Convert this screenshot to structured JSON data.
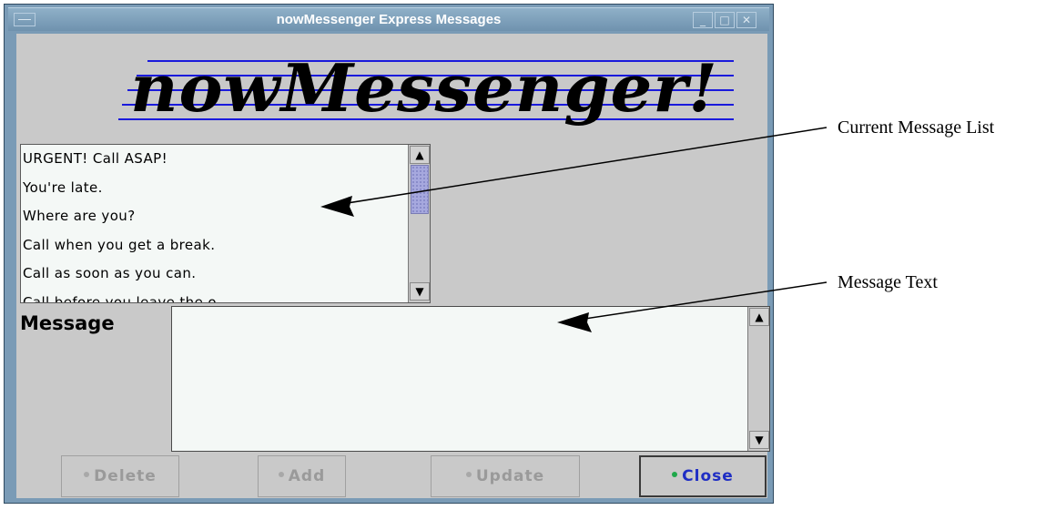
{
  "window": {
    "title": "nowMessenger Express Messages",
    "logo_text": "nowMessenger!"
  },
  "message_list": {
    "items": [
      "URGENT! Call ASAP!",
      "You're late.",
      "Where are you?",
      "Call when you get a break.",
      "Call as soon as you can.",
      "Call before you leave the o"
    ]
  },
  "message": {
    "label": "Message",
    "text": ""
  },
  "buttons": {
    "delete": "Delete",
    "add": "Add",
    "update": "Update",
    "close": "Close"
  },
  "annotations": {
    "message_list": "Current Message List",
    "message_text": "Message Text"
  },
  "colors": {
    "title_bar": "#7a9bb6",
    "logo_lines": "#1a1adc",
    "scroll_thumb": "#a6a8de",
    "close_text": "#1f2ec4",
    "close_indicator": "#1fa84a",
    "disabled_text": "#9a9a9a"
  },
  "icons": {
    "window_menu": "window-menu-icon",
    "minimize": "minimize-icon",
    "maximize": "maximize-icon",
    "close": "close-icon",
    "scroll_up": "arrow-up-icon",
    "scroll_down": "arrow-down-icon"
  }
}
